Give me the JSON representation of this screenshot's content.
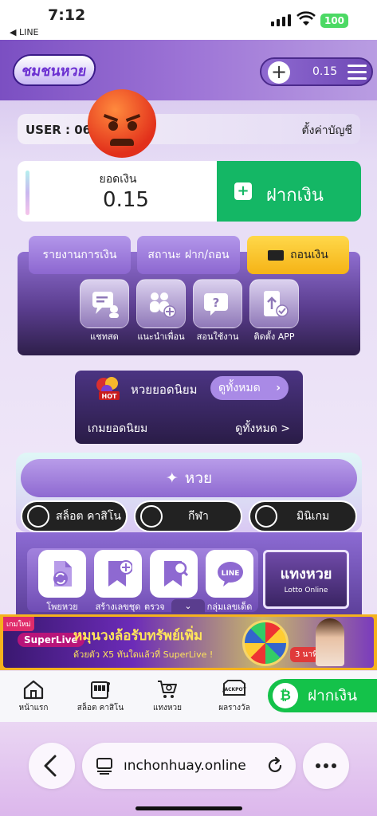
{
  "status": {
    "time": "7:12",
    "back_app": "◀ LINE",
    "battery": "100"
  },
  "header": {
    "logo_text": "ชมชนหวย",
    "credit": "0.15"
  },
  "user": {
    "label": "USER : 063",
    "account_settings": "ตั้งค่าบัญชี"
  },
  "balance": {
    "label": "ยอดเงิน",
    "value": "0.15",
    "deposit_label": "ฝากเงิน"
  },
  "menu": {
    "tabs": [
      {
        "label": "รายงานการเงิน"
      },
      {
        "label": "สถานะ ฝาก/ถอน"
      },
      {
        "label": "ถอนเงิน"
      }
    ],
    "icons": [
      {
        "label": "แชทสด",
        "icon": "chat-icon"
      },
      {
        "label": "แนะนำเพื่อน",
        "icon": "invite-friends-icon"
      },
      {
        "label": "สอนใช้งาน",
        "icon": "help-icon"
      },
      {
        "label": "ติดตั้ง APP",
        "icon": "install-app-icon"
      }
    ]
  },
  "popular": {
    "title": "หวยยอดนิยม",
    "view_all": "ดูทั้งหมด",
    "hot": "HOT",
    "games_label": "เกมยอดนิยม",
    "games_view_all": "ดูทั้งหมด >"
  },
  "categories": {
    "lotto": "หวย",
    "items": [
      {
        "label": "สล็อต คาสิโน"
      },
      {
        "label": "กีฬา"
      },
      {
        "label": "มินิเกม"
      }
    ],
    "sub_items": [
      {
        "label": "โพยหวย",
        "icon": "lotto-ticket-icon"
      },
      {
        "label": "สร้างเลขชุด",
        "icon": "bookmark-add-icon"
      },
      {
        "label": "ตรวจ",
        "icon": "bookmark-search-icon"
      },
      {
        "label": "กลุ่มเลขเด็ด",
        "icon": "line-icon"
      }
    ],
    "line_text": "LINE",
    "lotto_big_title": "แทงหวย",
    "lotto_big_sub": "Lotto Online"
  },
  "banner": {
    "tag": "เกมใหม่",
    "brand": "SuperLive",
    "headline": "หมุนวงล้อรับทรัพย์เพิ่ม",
    "subline": "ด้วยตัว X5 ทันใดแล้วที่ SuperLive !",
    "badge": "3 นาที"
  },
  "bottom_nav": {
    "items": [
      {
        "label": "หน้าแรก",
        "icon": "home-icon"
      },
      {
        "label": "สล็อต คาสิโน",
        "icon": "slot-machine-icon"
      },
      {
        "label": "แทงหวย",
        "icon": "cart-icon"
      },
      {
        "label": "ผลรางวัล",
        "icon": "jackpot-icon"
      }
    ],
    "jackpot_text": "JACKPOT",
    "deposit_label": "ฝากเงิน"
  },
  "browser": {
    "url": "ınchonhuay.online"
  }
}
